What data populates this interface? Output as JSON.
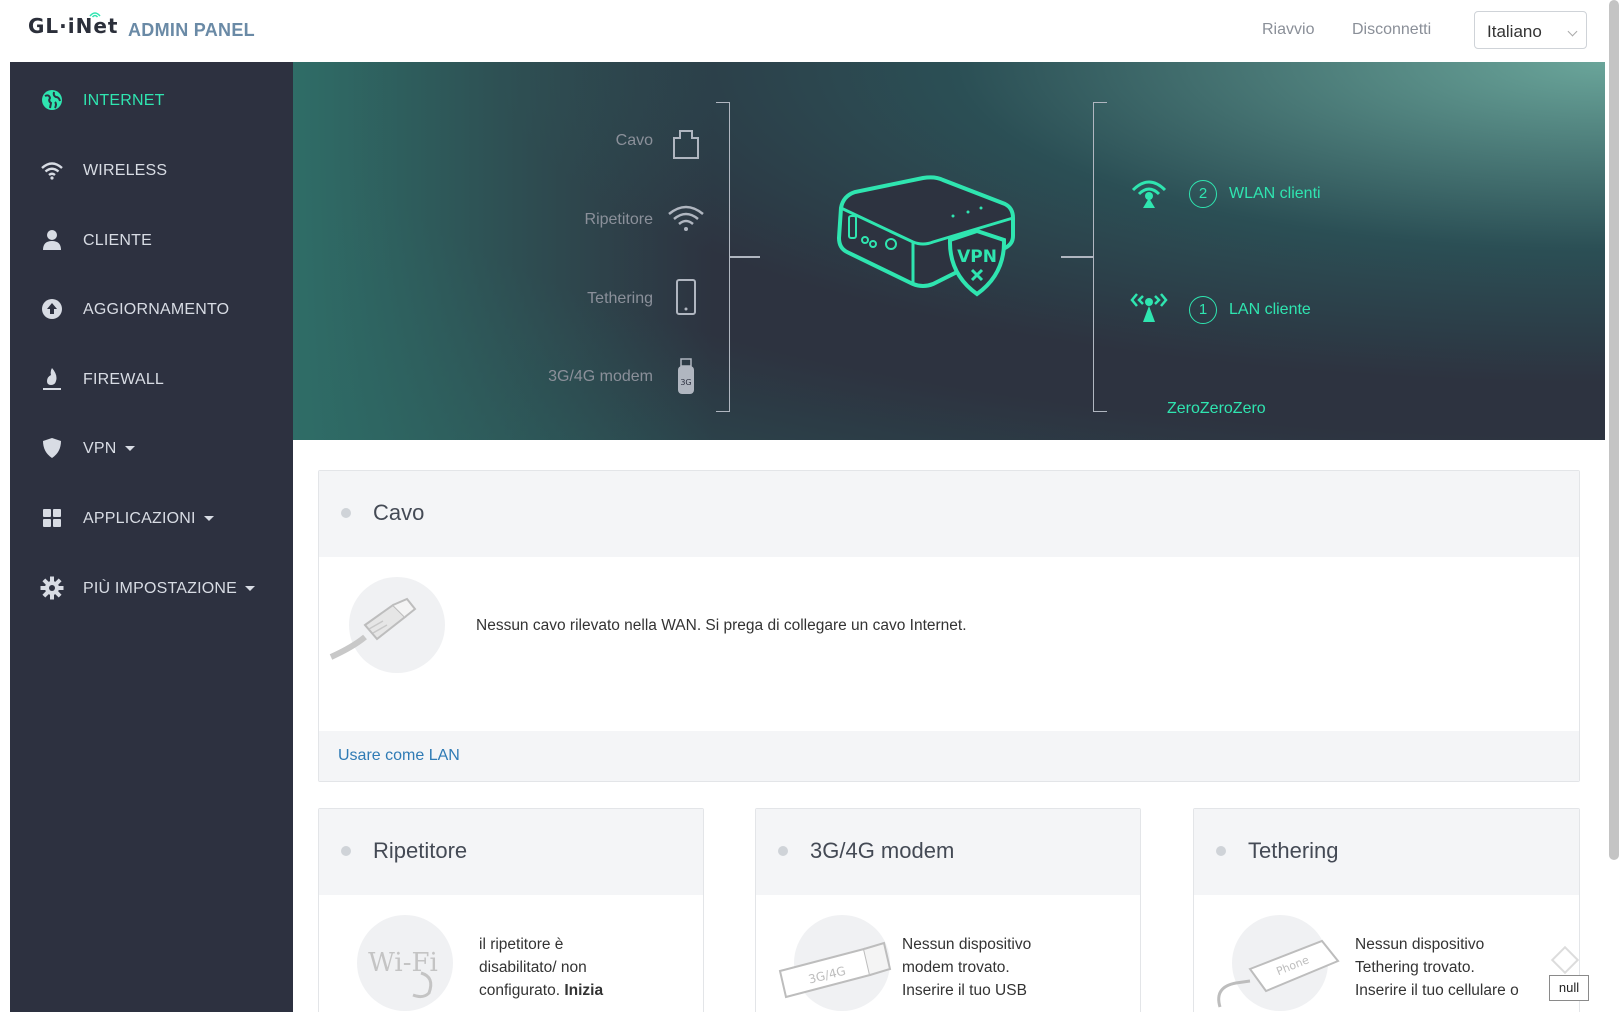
{
  "header": {
    "logo": "GL·iNet",
    "title": "ADMIN PANEL",
    "reboot": "Riavvio",
    "logout": "Disconnetti",
    "language": "Italiano"
  },
  "sidebar": {
    "items": [
      {
        "label": "INTERNET",
        "icon": "globe-icon",
        "active": true
      },
      {
        "label": "WIRELESS",
        "icon": "wifi-icon"
      },
      {
        "label": "CLIENTE",
        "icon": "user-icon"
      },
      {
        "label": "AGGIORNAMENTO",
        "icon": "upload-icon"
      },
      {
        "label": "FIREWALL",
        "icon": "flame-icon"
      },
      {
        "label": "VPN",
        "icon": "shield-icon",
        "dropdown": true
      },
      {
        "label": "APPLICAZIONI",
        "icon": "grid-icon",
        "dropdown": true
      },
      {
        "label": "PIÙ IMPOSTAZIONE",
        "icon": "gear-icon",
        "dropdown": true
      }
    ]
  },
  "banner": {
    "sources": [
      {
        "label": "Cavo",
        "icon": "ethernet-port-icon"
      },
      {
        "label": "Ripetitore",
        "icon": "wifi-icon"
      },
      {
        "label": "Tethering",
        "icon": "phone-icon"
      },
      {
        "label": "3G/4G modem",
        "icon": "usb-modem-icon"
      }
    ],
    "device_name": "ZeroZeroZero",
    "vpn_badge": "VPN",
    "clients": [
      {
        "count": "2",
        "label": "WLAN clienti",
        "icon": "wireless-antenna-icon"
      },
      {
        "count": "1",
        "label": "LAN cliente",
        "icon": "lan-antenna-icon"
      }
    ]
  },
  "cards": {
    "cable": {
      "title": "Cavo",
      "message": "Nessun cavo rilevato nella WAN. Si prega di collegare un cavo Internet.",
      "link": "Usare come LAN"
    },
    "repeater": {
      "title": "Ripetitore",
      "message_1": "il ripetitore è",
      "message_2": "disabilitato/ non",
      "message_3": "configurato.",
      "message_bold": "Inizia",
      "illus_text": "Wi-Fi"
    },
    "modem": {
      "title": "3G/4G modem",
      "message_1": "Nessun dispositivo",
      "message_2": "modem trovato.",
      "message_3": "Inserire il tuo USB",
      "illus_text": "3G/4G"
    },
    "tethering": {
      "title": "Tethering",
      "message_1": "Nessun dispositivo",
      "message_2": "Tethering trovato.",
      "message_3": "Inserire il tuo cellulare o",
      "illus_text": "Phone"
    }
  },
  "null_badge": "null",
  "colors": {
    "accent": "#2fe5b0",
    "sidebar_bg": "#2d3140",
    "link": "#2f7bb5"
  }
}
